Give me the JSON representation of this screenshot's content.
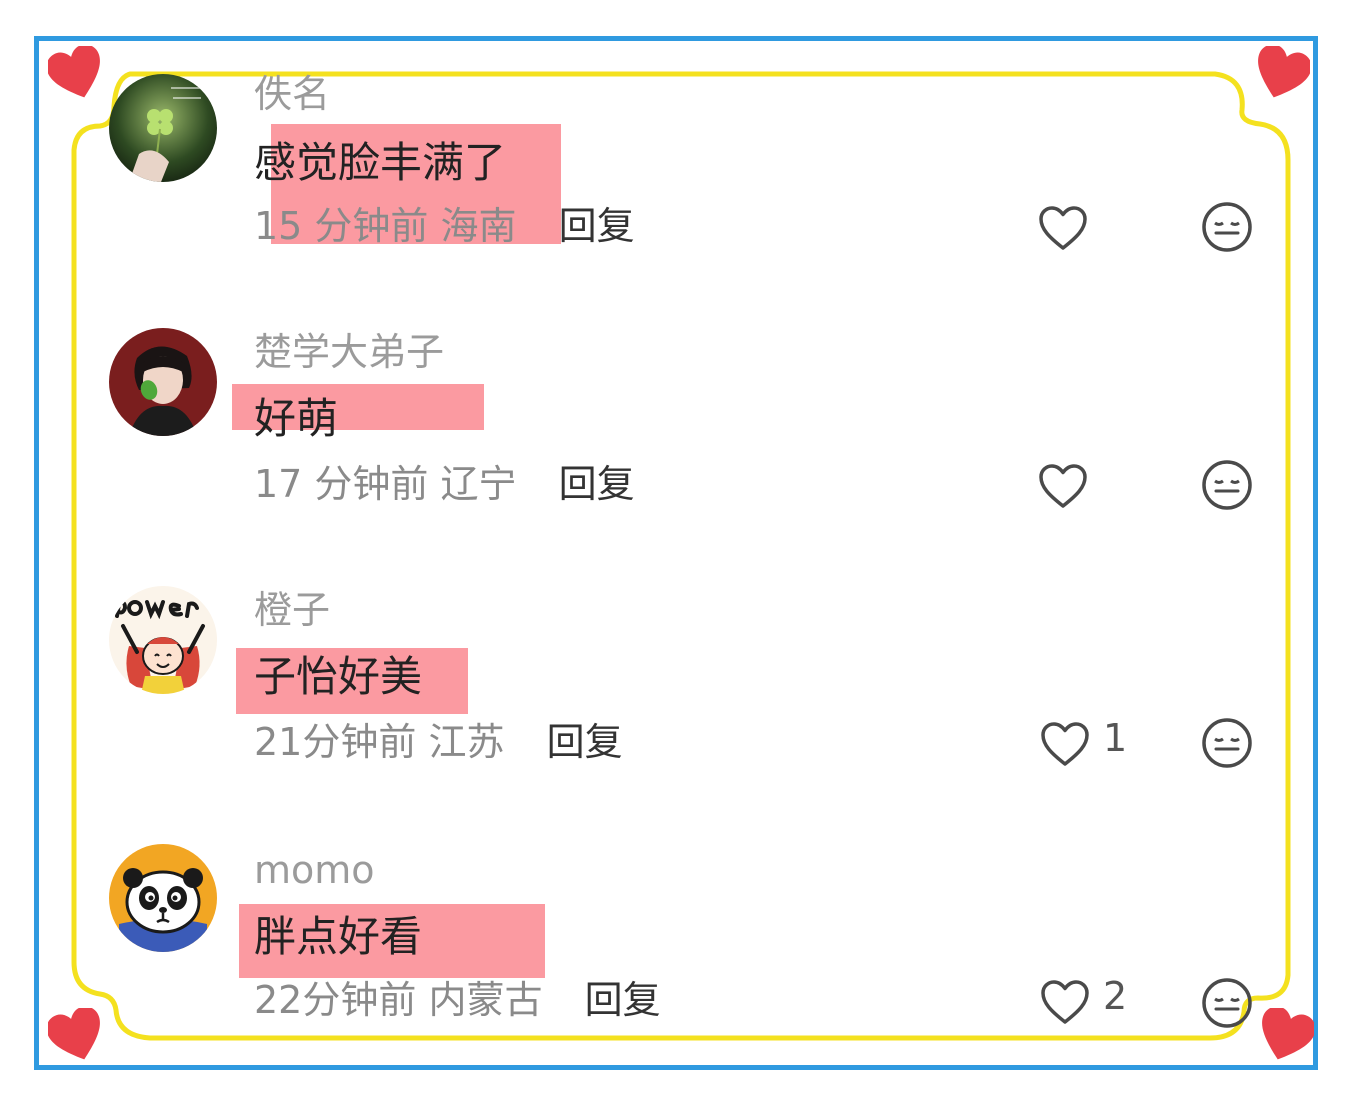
{
  "comments": [
    {
      "username": "佚名",
      "text": "感觉脸丰满了",
      "time": "15 分钟前",
      "location": "海南",
      "reply_label": "回复",
      "likes": ""
    },
    {
      "username": "楚学大弟子",
      "text": "好萌",
      "time": "17 分钟前",
      "location": "辽宁",
      "reply_label": "回复",
      "likes": ""
    },
    {
      "username": "橙子",
      "text": "子怡好美",
      "time": "21分钟前",
      "location": "江苏",
      "reply_label": "回复",
      "likes": "1"
    },
    {
      "username": "momo",
      "text": "胖点好看",
      "time": "22分钟前",
      "location": "内蒙古",
      "reply_label": "回复",
      "likes": "2"
    }
  ],
  "colors": {
    "border_blue": "#2f9ae0",
    "border_yellow": "#f4e11f",
    "heart_red": "#e8404a",
    "highlight": "#f98a90"
  },
  "icons": {
    "like": "heart-outline-icon",
    "dislike": "meh-face-icon",
    "decoration": "red-heart-icon"
  }
}
